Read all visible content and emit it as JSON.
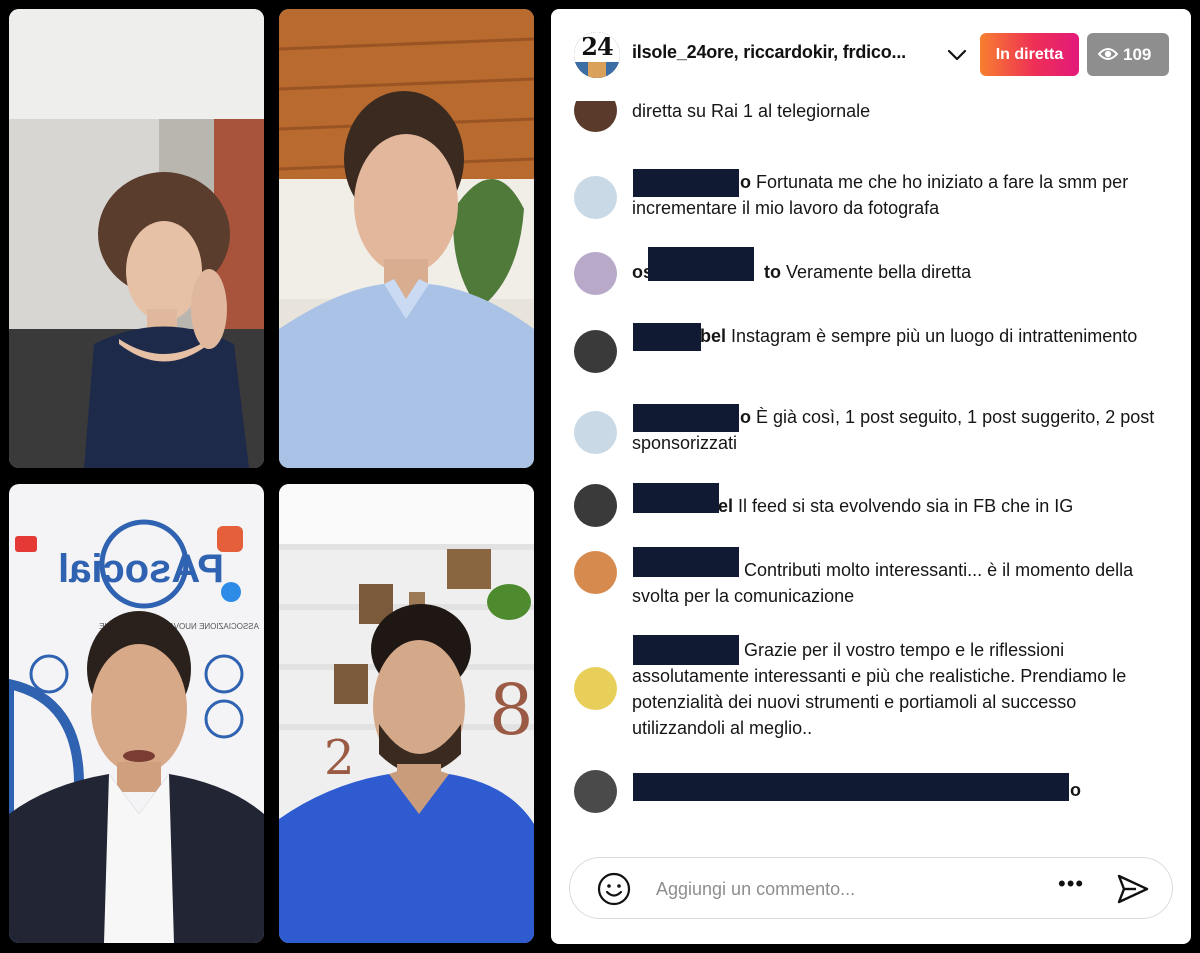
{
  "header": {
    "avatar_logo": "24",
    "title": "ilsole_24ore, riccardokir, frdico...",
    "live_label": "In diretta",
    "viewers": "109",
    "live_gradient": [
      "#f77f2f",
      "#ee2f56",
      "#e3197a"
    ]
  },
  "banner": {
    "logo_text": "PAsocial",
    "association_text": "ASSOCIAZIONE NUOVA COMUNICAZIONE"
  },
  "comments": [
    {
      "user": "",
      "text": "diretta su Rai 1 al telegiornale"
    },
    {
      "user": "o",
      "text": "Fortunata me che ho iniziato a fare la smm per incrementare il mio lavoro da fotografa"
    },
    {
      "user": "os",
      "user_tail": "to",
      "text": "Veramente bella diretta"
    },
    {
      "user": "bel",
      "text": "Instagram è sempre più un luogo di intrattenimento"
    },
    {
      "user": "o",
      "text": "È già così, 1 post seguito, 1 post suggerito, 2 post sponsorizzati"
    },
    {
      "user": "el",
      "text": "Il feed si sta evolvendo sia in FB che in IG"
    },
    {
      "user": "",
      "text": "Contributi molto interessanti... è il momento della svolta per la comunicazione"
    },
    {
      "user": "",
      "text": "Grazie per il vostro tempo e le riflessioni assolutamente interessanti e più che realistiche. Prendiamo le potenzialità dei nuovi strumenti e portiamoli al successo utilizzandoli al meglio.."
    },
    {
      "user": "o",
      "text": ""
    }
  ],
  "composer": {
    "placeholder": "Aggiungi un commento..."
  },
  "icons": {
    "emoji": "smiley-icon",
    "more": "more-icon",
    "send": "send-icon",
    "eye": "eye-icon",
    "chevron": "chevron-down-icon"
  },
  "colors": {
    "redaction": "#101a33",
    "viewers_badge": "#8e8e8e"
  }
}
